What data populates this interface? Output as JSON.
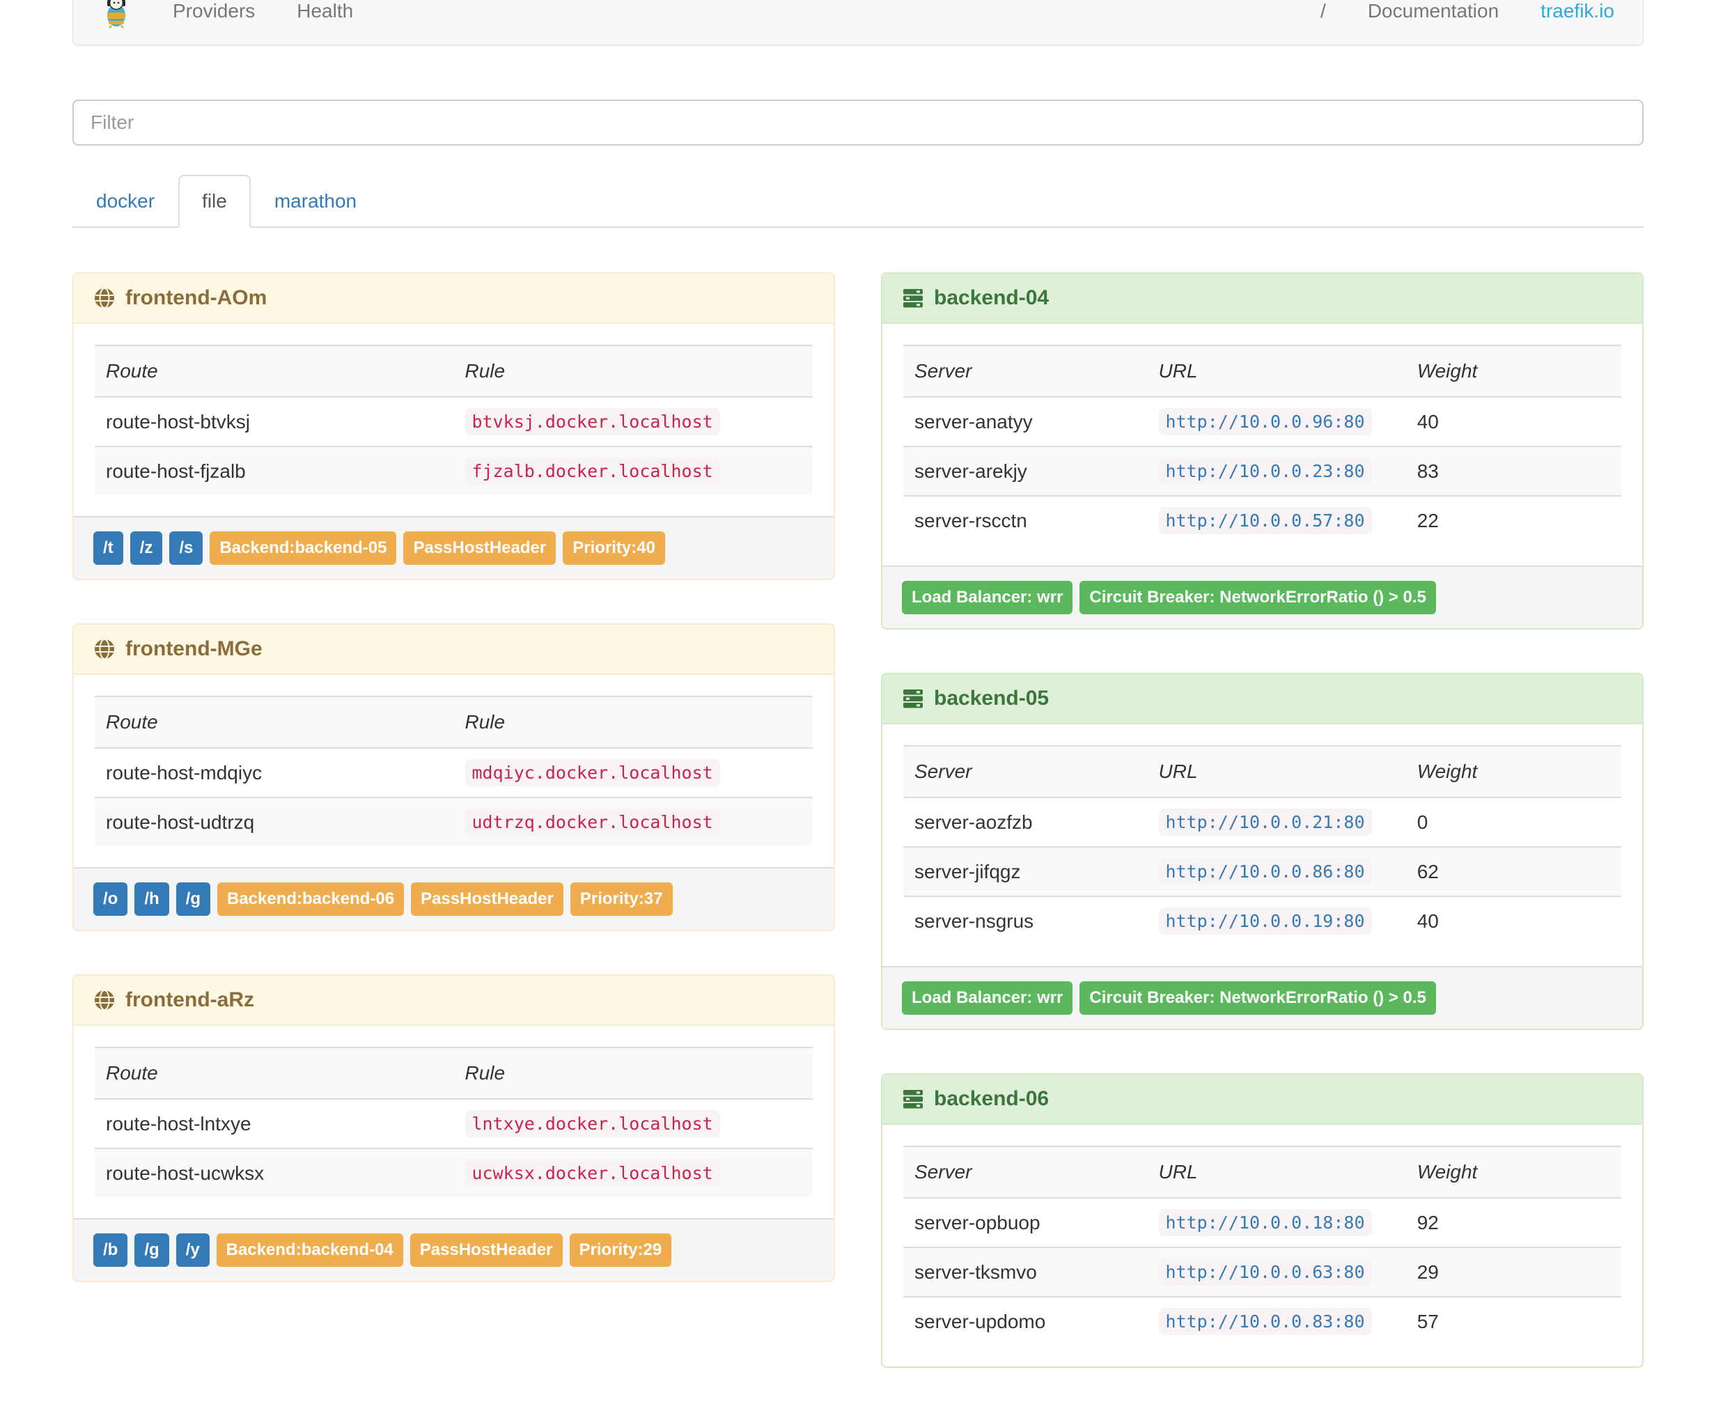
{
  "navbar": {
    "brand_icon": "traefik-logo",
    "providers_label": "Providers",
    "health_label": "Health",
    "separator": "/",
    "documentation_label": "Documentation",
    "traefik_io_label": "traefik.io"
  },
  "filter": {
    "placeholder": "Filter"
  },
  "tabs": [
    {
      "label": "docker",
      "active": false
    },
    {
      "label": "file",
      "active": true
    },
    {
      "label": "marathon",
      "active": false
    }
  ],
  "frontend_columns": [
    "Route",
    "Rule"
  ],
  "backend_columns": [
    "Server",
    "URL",
    "Weight"
  ],
  "frontends": [
    {
      "name": "frontend-AOm",
      "icon": "globe-icon",
      "rows": [
        {
          "route": "route-host-btvksj",
          "rule": "btvksj.docker.localhost"
        },
        {
          "route": "route-host-fjzalb",
          "rule": "fjzalb.docker.localhost"
        }
      ],
      "route_badges": [
        "/t",
        "/z",
        "/s"
      ],
      "detail_badges": [
        "Backend:backend-05",
        "PassHostHeader",
        "Priority:40"
      ]
    },
    {
      "name": "frontend-MGe",
      "icon": "globe-icon",
      "rows": [
        {
          "route": "route-host-mdqiyc",
          "rule": "mdqiyc.docker.localhost"
        },
        {
          "route": "route-host-udtrzq",
          "rule": "udtrzq.docker.localhost"
        }
      ],
      "route_badges": [
        "/o",
        "/h",
        "/g"
      ],
      "detail_badges": [
        "Backend:backend-06",
        "PassHostHeader",
        "Priority:37"
      ]
    },
    {
      "name": "frontend-aRz",
      "icon": "globe-icon",
      "rows": [
        {
          "route": "route-host-lntxye",
          "rule": "lntxye.docker.localhost"
        },
        {
          "route": "route-host-ucwksx",
          "rule": "ucwksx.docker.localhost"
        }
      ],
      "route_badges": [
        "/b",
        "/g",
        "/y"
      ],
      "detail_badges": [
        "Backend:backend-04",
        "PassHostHeader",
        "Priority:29"
      ]
    }
  ],
  "backends": [
    {
      "name": "backend-04",
      "icon": "servers-icon",
      "rows": [
        {
          "server": "server-anatyy",
          "url": "http://10.0.0.96:80",
          "weight": "40"
        },
        {
          "server": "server-arekjy",
          "url": "http://10.0.0.23:80",
          "weight": "83"
        },
        {
          "server": "server-rscctn",
          "url": "http://10.0.0.57:80",
          "weight": "22"
        }
      ],
      "badges": [
        "Load Balancer: wrr",
        "Circuit Breaker: NetworkErrorRatio () > 0.5"
      ]
    },
    {
      "name": "backend-05",
      "icon": "servers-icon",
      "rows": [
        {
          "server": "server-aozfzb",
          "url": "http://10.0.0.21:80",
          "weight": "0"
        },
        {
          "server": "server-jifqgz",
          "url": "http://10.0.0.86:80",
          "weight": "62"
        },
        {
          "server": "server-nsgrus",
          "url": "http://10.0.0.19:80",
          "weight": "40"
        }
      ],
      "badges": [
        "Load Balancer: wrr",
        "Circuit Breaker: NetworkErrorRatio () > 0.5"
      ]
    },
    {
      "name": "backend-06",
      "icon": "servers-icon",
      "rows": [
        {
          "server": "server-opbuop",
          "url": "http://10.0.0.18:80",
          "weight": "92"
        },
        {
          "server": "server-tksmvo",
          "url": "http://10.0.0.63:80",
          "weight": "29"
        },
        {
          "server": "server-updomo",
          "url": "http://10.0.0.83:80",
          "weight": "57"
        }
      ],
      "badges": []
    }
  ],
  "colors": {
    "primary_badge": "#337ab7",
    "warning_badge": "#f0ad4e",
    "success_badge": "#5cb85c",
    "rule_code": "#c7254e",
    "url_code": "#337ab7",
    "frontend_header_bg": "#fcf8e3",
    "frontend_header_text": "#8a6d3b",
    "backend_header_bg": "#dff0d8",
    "backend_header_text": "#3c763d",
    "external_link": "#29aae1"
  }
}
